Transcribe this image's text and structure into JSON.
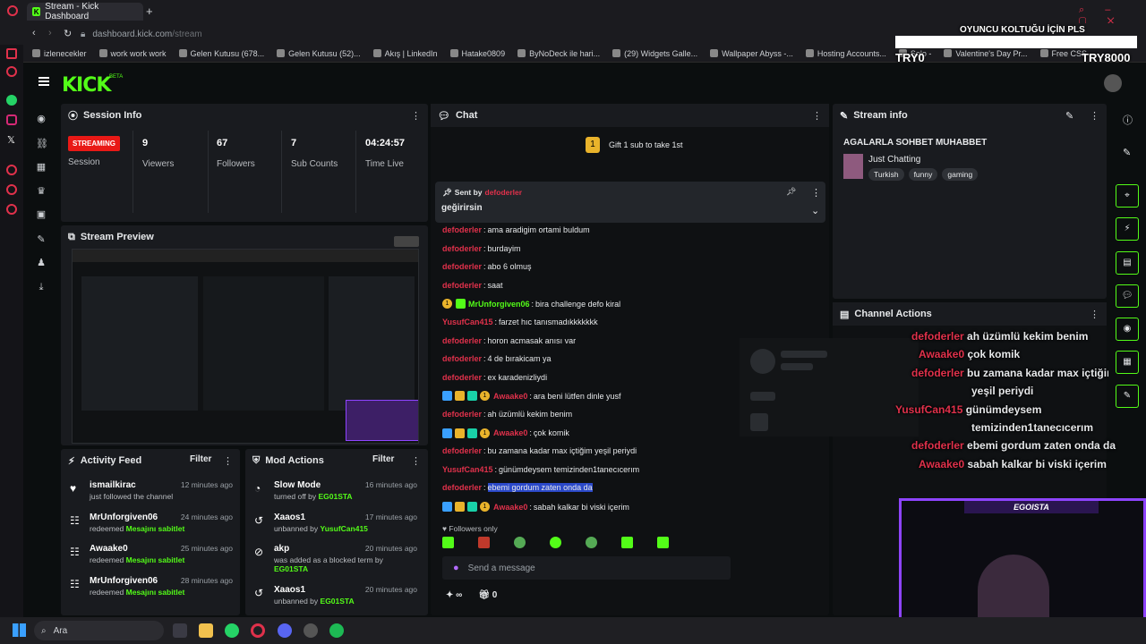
{
  "browser": {
    "tab_title": "Stream - Kick Dashboard",
    "url_host": "dashboard.kick.com",
    "url_path": "/stream",
    "bookmarks": [
      "izlenecekler",
      "work work work",
      "Gelen Kutusu (678...",
      "Gelen Kutusu (52)...",
      "Akış | LinkedIn",
      "Hatake0809",
      "ByNoDeck ile hari...",
      "(29) Widgets Galle...",
      "Wallpaper Abyss -...",
      "Hosting Accounts...",
      "Solo -",
      "Valentine's Day Pr...",
      "Free CSS"
    ],
    "overlay_top_text": "OYUNCU KOLTUĞU İÇİN PLS",
    "overlay_left": "TRY0",
    "overlay_right": "TRY8000"
  },
  "kick": {
    "logo": "KICK",
    "beta": "BETA"
  },
  "session": {
    "title": "Session Info",
    "badge": "STREAMING",
    "badge_sub": "Session",
    "stats": [
      {
        "value": "9",
        "label": "Viewers"
      },
      {
        "value": "67",
        "label": "Followers"
      },
      {
        "value": "7",
        "label": "Sub Counts"
      },
      {
        "value": "04:24:57",
        "label": "Time Live"
      }
    ]
  },
  "preview": {
    "title": "Stream Preview"
  },
  "activity": {
    "title": "Activity Feed",
    "filter": "Filter",
    "items": [
      {
        "name": "ismailkirac",
        "sub": "just followed the channel",
        "time": "12 minutes ago",
        "icon": "heart-icon"
      },
      {
        "name": "MrUnforgiven06",
        "sub_prefix": "redeemed ",
        "sub_em": "Mesajını sabitlet",
        "time": "24 minutes ago",
        "icon": "redeem-icon"
      },
      {
        "name": "Awaake0",
        "sub_prefix": "redeemed ",
        "sub_em": "Mesajını sabitlet",
        "time": "25 minutes ago",
        "icon": "redeem-icon"
      },
      {
        "name": "MrUnforgiven06",
        "sub_prefix": "redeemed ",
        "sub_em": "Mesajını sabitlet",
        "time": "28 minutes ago",
        "icon": "redeem-icon"
      }
    ]
  },
  "mod": {
    "title": "Mod Actions",
    "filter": "Filter",
    "items": [
      {
        "name": "Slow Mode",
        "sub_prefix": "turned off by ",
        "sub_em": "EG01STA",
        "time": "16 minutes ago"
      },
      {
        "name": "Xaaos1",
        "sub_prefix": "unbanned by ",
        "sub_em": "YusufCan415",
        "time": "17 minutes ago"
      },
      {
        "name": "akp",
        "sub_prefix": "was added as a blocked term by ",
        "sub_em": "EG01STA",
        "time": "20 minutes ago"
      },
      {
        "name": "Xaaos1",
        "sub_prefix": "unbanned by ",
        "sub_em": "EG01STA",
        "time": "20 minutes ago"
      }
    ]
  },
  "chat": {
    "title": "Chat",
    "gift": "Gift 1 sub to take 1st",
    "gift_count": "1",
    "pinned_by_label": "Sent by",
    "pinned_by": "defoderler",
    "pinned_text": "geğirirsin",
    "messages": [
      {
        "user": "defoderler",
        "text": "ama aradigim ortami buldum",
        "color": "#e0314b"
      },
      {
        "user": "defoderler",
        "text": "burdayim",
        "color": "#e0314b"
      },
      {
        "user": "defoderler",
        "text": "abo 6 olmuş",
        "color": "#e0314b"
      },
      {
        "user": "defoderler",
        "text": "saat",
        "color": "#e0314b"
      },
      {
        "user": "MrUnforgiven06",
        "text": "bira challenge defo kiral",
        "color": "#53fc18",
        "badges": 2
      },
      {
        "user": "YusufCan415",
        "text": "farzet hıc tanısmadıkkkkkkk",
        "color": "#e0314b"
      },
      {
        "user": "defoderler",
        "text": "horon acmasak anısı var",
        "color": "#e0314b"
      },
      {
        "user": "defoderler",
        "text": "4 de bırakicam ya",
        "color": "#e0314b"
      },
      {
        "user": "defoderler",
        "text": "ex karadenizliydi",
        "color": "#e0314b"
      },
      {
        "user": "Awaake0",
        "text": "ara beni lütfen dinle yusf",
        "color": "#e0314b",
        "badges": 4
      },
      {
        "user": "defoderler",
        "text": "ah üzümlü kekim benim",
        "color": "#e0314b"
      },
      {
        "user": "Awaake0",
        "text": "çok komik",
        "color": "#e0314b",
        "badges": 4
      },
      {
        "user": "defoderler",
        "text": "bu zamana kadar max içtiğim yeşil periydi",
        "color": "#e0314b"
      },
      {
        "user": "YusufCan415",
        "text": "günümdeysem temizinden1tanecıcerım",
        "color": "#e0314b"
      },
      {
        "user": "defoderler",
        "text": "ebemi gordum zaten onda da",
        "color": "#e0314b",
        "highlight": true
      },
      {
        "user": "Awaake0",
        "text": "sabah kalkar bi viski içerim",
        "color": "#e0314b",
        "badges": 4
      }
    ],
    "followers_only": "Followers only",
    "placeholder": "Send a message",
    "points": "∞",
    "gifts": "0"
  },
  "stream_info": {
    "title": "Stream info",
    "stream_title": "AGALARLA SOHBET MUHABBET",
    "category": "Just Chatting",
    "tags": [
      "Turkish",
      "funny",
      "gaming"
    ]
  },
  "channel_actions": {
    "title": "Channel Actions"
  },
  "overlay_chat": [
    {
      "user": "defoderler",
      "text": "ah üzümlü kekim benim"
    },
    {
      "user": "Awaake0",
      "text": "çok komik"
    },
    {
      "user": "defoderler",
      "text": "bu zamana kadar max içtiğim"
    },
    {
      "user": "",
      "text": "yeşil periydi"
    },
    {
      "user": "YusufCan415",
      "text": "günümdeysem"
    },
    {
      "user": "",
      "text": "temizinden1tanecıcerım"
    },
    {
      "user": "defoderler",
      "text": "ebemi gordum zaten onda da"
    },
    {
      "user": "Awaake0",
      "text": "sabah kalkar bi viski içerim"
    }
  ],
  "webcam": {
    "name": "EGOISTA"
  },
  "taskbar": {
    "search": "Ara"
  }
}
